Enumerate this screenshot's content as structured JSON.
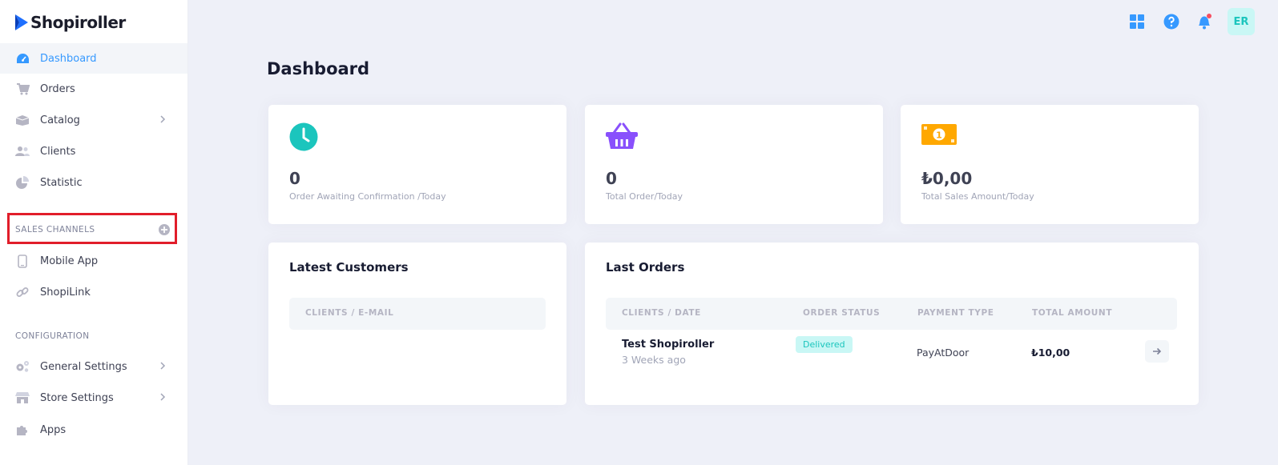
{
  "app": {
    "name": "Shopiroller"
  },
  "sidebar": {
    "items": [
      {
        "label": "Dashboard",
        "icon": "dashboard-icon"
      },
      {
        "label": "Orders",
        "icon": "cart-icon"
      },
      {
        "label": "Catalog",
        "icon": "catalog-icon"
      },
      {
        "label": "Clients",
        "icon": "clients-icon"
      },
      {
        "label": "Statistic",
        "icon": "pie-chart-icon"
      }
    ],
    "sales_channels_title": "SALES CHANNELS",
    "sales_channels": [
      {
        "label": "Mobile App",
        "icon": "mobile-icon"
      },
      {
        "label": "ShopiLink",
        "icon": "link-icon"
      }
    ],
    "configuration_title": "CONFIGURATION",
    "configuration": [
      {
        "label": "General Settings",
        "icon": "gears-icon"
      },
      {
        "label": "Store Settings",
        "icon": "store-icon"
      },
      {
        "label": "Apps",
        "icon": "puzzle-icon"
      }
    ]
  },
  "topbar": {
    "avatar_initials": "ER"
  },
  "page": {
    "title": "Dashboard"
  },
  "stats": [
    {
      "value": "0",
      "label": "Order Awaiting Confirmation /Today",
      "icon": "clock-icon",
      "color": "#1bc5bd"
    },
    {
      "value": "0",
      "label": "Total Order/Today",
      "icon": "basket-icon",
      "color": "#8950fc"
    },
    {
      "value": "₺0,00",
      "label": "Total Sales Amount/Today",
      "icon": "money-icon",
      "color": "#ffa800"
    }
  ],
  "latest_customers": {
    "title": "Latest Customers",
    "column": "CLIENTS / E-MAIL"
  },
  "last_orders": {
    "title": "Last Orders",
    "columns": [
      "CLIENTS / DATE",
      "ORDER STATUS",
      "PAYMENT TYPE",
      "TOTAL AMOUNT"
    ],
    "rows": [
      {
        "client": "Test Shopiroller",
        "date": "3 Weeks ago",
        "status": "Delivered",
        "payment": "PayAtDoor",
        "amount": "₺10,00"
      }
    ]
  },
  "colors": {
    "accent": "#3699ff",
    "highlight_box": "#e11d2a"
  }
}
